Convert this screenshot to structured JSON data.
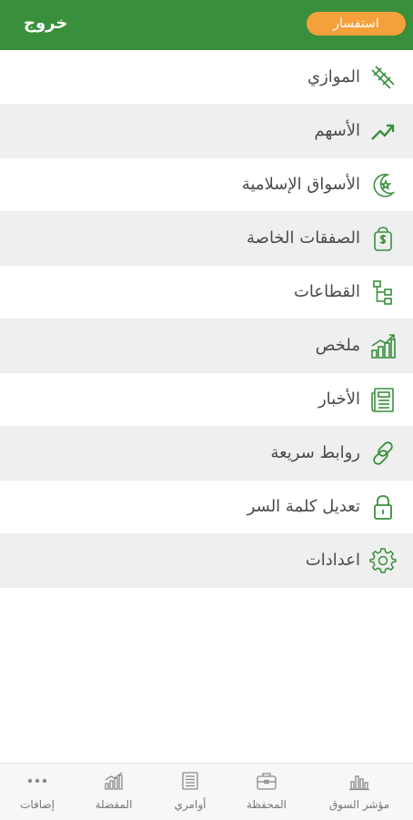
{
  "header": {
    "logout_label": "خروج",
    "inquiry_label": "استفسار",
    "colors": {
      "bar": "#3a8f3c",
      "inquiry_button": "#f4a13c"
    }
  },
  "menu": {
    "items": [
      {
        "label": "الموازي",
        "icon": "parallel-market-icon"
      },
      {
        "label": "الأسهم",
        "icon": "trend-up-arrow-icon"
      },
      {
        "label": "الأسواق الإسلامية",
        "icon": "crescent-star-icon"
      },
      {
        "label": "الصفقات الخاصة",
        "icon": "money-bag-icon"
      },
      {
        "label": "القطاعات",
        "icon": "sectors-tree-icon"
      },
      {
        "label": "ملخص",
        "icon": "summary-chart-icon"
      },
      {
        "label": "الأخبار",
        "icon": "newspaper-icon"
      },
      {
        "label": "روابط سريعة",
        "icon": "link-icon"
      },
      {
        "label": "تعديل كلمة السر",
        "icon": "lock-icon"
      },
      {
        "label": "اعدادات",
        "icon": "gear-icon"
      }
    ],
    "accent_color": "#3a8f3c"
  },
  "tabbar": {
    "tabs": [
      {
        "label": "مؤشر السوق",
        "icon": "bar-chart-icon"
      },
      {
        "label": "المحفظة",
        "icon": "briefcase-icon"
      },
      {
        "label": "أوامري",
        "icon": "orders-list-icon"
      },
      {
        "label": "المفضلة",
        "icon": "favorites-chart-icon"
      },
      {
        "label": "إضافات",
        "icon": "more-dots-icon"
      }
    ]
  }
}
